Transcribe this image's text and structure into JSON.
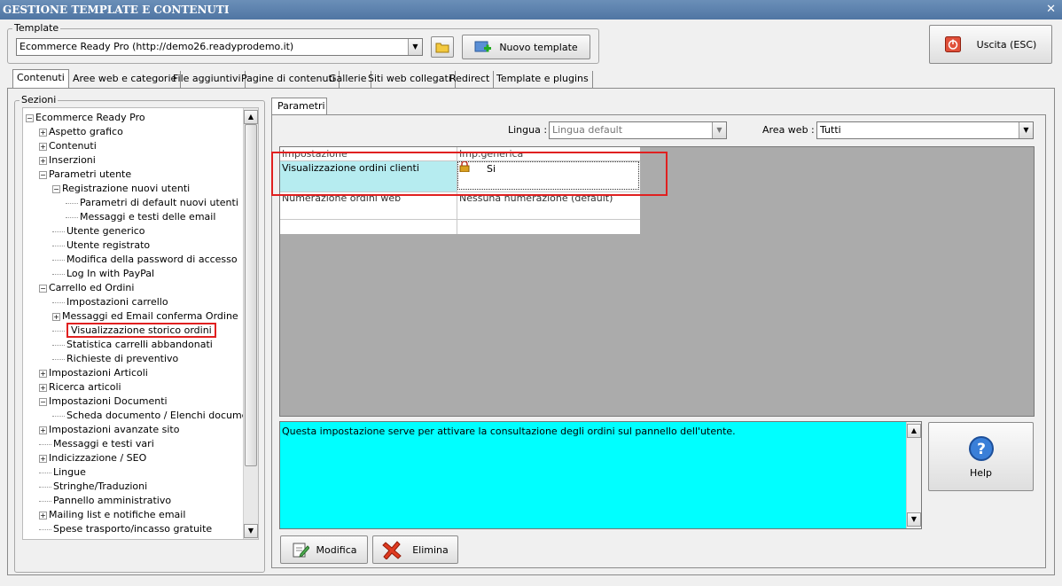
{
  "window": {
    "title": "GESTIONE TEMPLATE E CONTENUTI",
    "close": "✕"
  },
  "template": {
    "group_label": "Template",
    "selected": "Ecommerce Ready Pro (http://demo26.readyprodemo.it)",
    "new_button": "Nuovo template"
  },
  "exit_button": "Uscita (ESC)",
  "tabs": [
    "Contenuti",
    "Aree web e categorie",
    "File aggiuntivi",
    "Pagine di contenuti",
    "Gallerie",
    "Siti web collegati",
    "Redirect",
    "Template e plugins"
  ],
  "sections": {
    "label": "Sezioni",
    "items": [
      {
        "text": "Ecommerce Ready Pro",
        "level": 0,
        "exp": "-"
      },
      {
        "text": "Aspetto grafico",
        "level": 1,
        "exp": "+"
      },
      {
        "text": "Contenuti",
        "level": 1,
        "exp": "+"
      },
      {
        "text": "Inserzioni",
        "level": 1,
        "exp": "+"
      },
      {
        "text": "Parametri utente",
        "level": 1,
        "exp": "-"
      },
      {
        "text": "Registrazione nuovi utenti",
        "level": 2,
        "exp": "-"
      },
      {
        "text": "Parametri di default nuovi utenti",
        "level": 3,
        "exp": ""
      },
      {
        "text": "Messaggi e testi delle email",
        "level": 3,
        "exp": ""
      },
      {
        "text": "Utente generico",
        "level": 2,
        "exp": ""
      },
      {
        "text": "Utente registrato",
        "level": 2,
        "exp": ""
      },
      {
        "text": "Modifica della password di accesso",
        "level": 2,
        "exp": ""
      },
      {
        "text": "Log In with PayPal",
        "level": 2,
        "exp": ""
      },
      {
        "text": "Carrello ed Ordini",
        "level": 1,
        "exp": "-"
      },
      {
        "text": "Impostazioni carrello",
        "level": 2,
        "exp": ""
      },
      {
        "text": "Messaggi ed Email conferma Ordine",
        "level": 2,
        "exp": "+"
      },
      {
        "text": "Visualizzazione storico ordini",
        "level": 2,
        "exp": "",
        "selected": true
      },
      {
        "text": "Statistica carrelli abbandonati",
        "level": 2,
        "exp": ""
      },
      {
        "text": "Richieste di preventivo",
        "level": 2,
        "exp": ""
      },
      {
        "text": "Impostazioni Articoli",
        "level": 1,
        "exp": "+"
      },
      {
        "text": "Ricerca articoli",
        "level": 1,
        "exp": "+"
      },
      {
        "text": "Impostazioni Documenti",
        "level": 1,
        "exp": "-"
      },
      {
        "text": "Scheda documento / Elenchi documenti",
        "level": 2,
        "exp": ""
      },
      {
        "text": "Impostazioni avanzate sito",
        "level": 1,
        "exp": "+"
      },
      {
        "text": "Messaggi e testi vari",
        "level": 1,
        "exp": ""
      },
      {
        "text": "Indicizzazione / SEO",
        "level": 1,
        "exp": "+"
      },
      {
        "text": "Lingue",
        "level": 1,
        "exp": ""
      },
      {
        "text": "Stringhe/Traduzioni",
        "level": 1,
        "exp": ""
      },
      {
        "text": "Pannello amministrativo",
        "level": 1,
        "exp": ""
      },
      {
        "text": "Mailing list e notifiche email",
        "level": 1,
        "exp": "+"
      },
      {
        "text": "Spese trasporto/incasso gratuite",
        "level": 1,
        "exp": ""
      }
    ]
  },
  "params": {
    "tab": "Parametri",
    "lingua_label": "Lingua :",
    "lingua_value": "Lingua default",
    "area_label": "Area web :",
    "area_value": "Tutti",
    "col1": "Impostazione",
    "col2": "Imp.generica",
    "rows": [
      {
        "name": "Visualizzazione ordini clienti",
        "value": "Si"
      },
      {
        "name": "Numerazione ordini web",
        "value": "Nessuna numerazione (default)"
      }
    ],
    "description": "Questa impostazione serve per attivare la consultazione degli ordini sul pannello dell'utente.",
    "help": "Help",
    "modifica": "Modifica",
    "elimina": "Elimina"
  }
}
